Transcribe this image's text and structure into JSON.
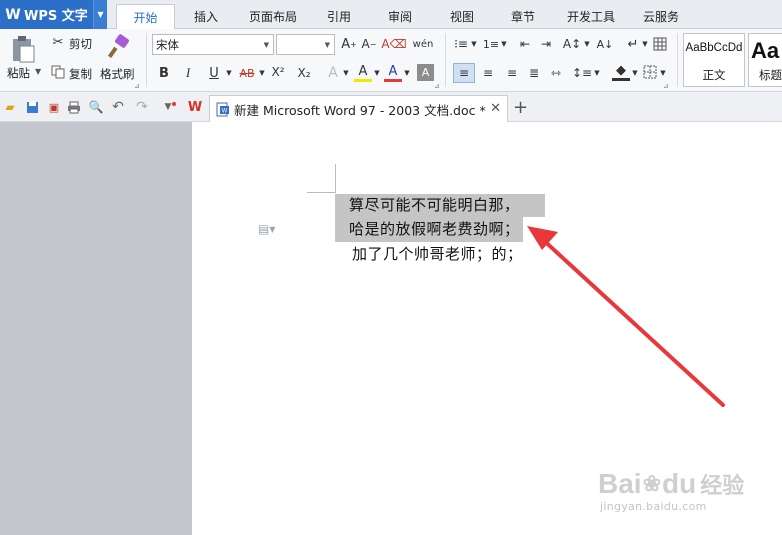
{
  "app": {
    "name": "WPS 文字",
    "logo": "W"
  },
  "ribbon_tabs": [
    {
      "label": "开始",
      "active": true
    },
    {
      "label": "插入"
    },
    {
      "label": "页面布局"
    },
    {
      "label": "引用"
    },
    {
      "label": "审阅"
    },
    {
      "label": "视图"
    },
    {
      "label": "章节"
    },
    {
      "label": "开发工具"
    },
    {
      "label": "云服务"
    }
  ],
  "clipboard": {
    "paste": "粘贴",
    "cut": "剪切",
    "copy": "复制",
    "format_painter": "格式刷"
  },
  "font": {
    "name": "宋体",
    "size": ""
  },
  "format_glyphs": {
    "bold": "B",
    "italic": "I",
    "underline": "U",
    "strike": "AB",
    "superscript": "X²",
    "subscript": "X₂",
    "font_color": "A",
    "highlight": "A"
  },
  "styles": [
    {
      "sample": "AaBbCcDd",
      "name": "正文"
    },
    {
      "sample": "Aa",
      "name": "标题"
    }
  ],
  "document_tab": {
    "title": "新建 Microsoft Word 97 - 2003 文档.doc *"
  },
  "document": {
    "lines": [
      "算尽可能不可能明白那，",
      "哈是的放假啊老费劲啊；",
      "加了几个帅哥老师；的；"
    ]
  },
  "colors": {
    "accent": "#2c6fc9",
    "arrow": "#e8383b",
    "selection": "#c5c5c5"
  },
  "watermark": {
    "brand": "Bai",
    "brand2": "du",
    "cn": "经验",
    "url": "jingyan.baidu.com"
  }
}
